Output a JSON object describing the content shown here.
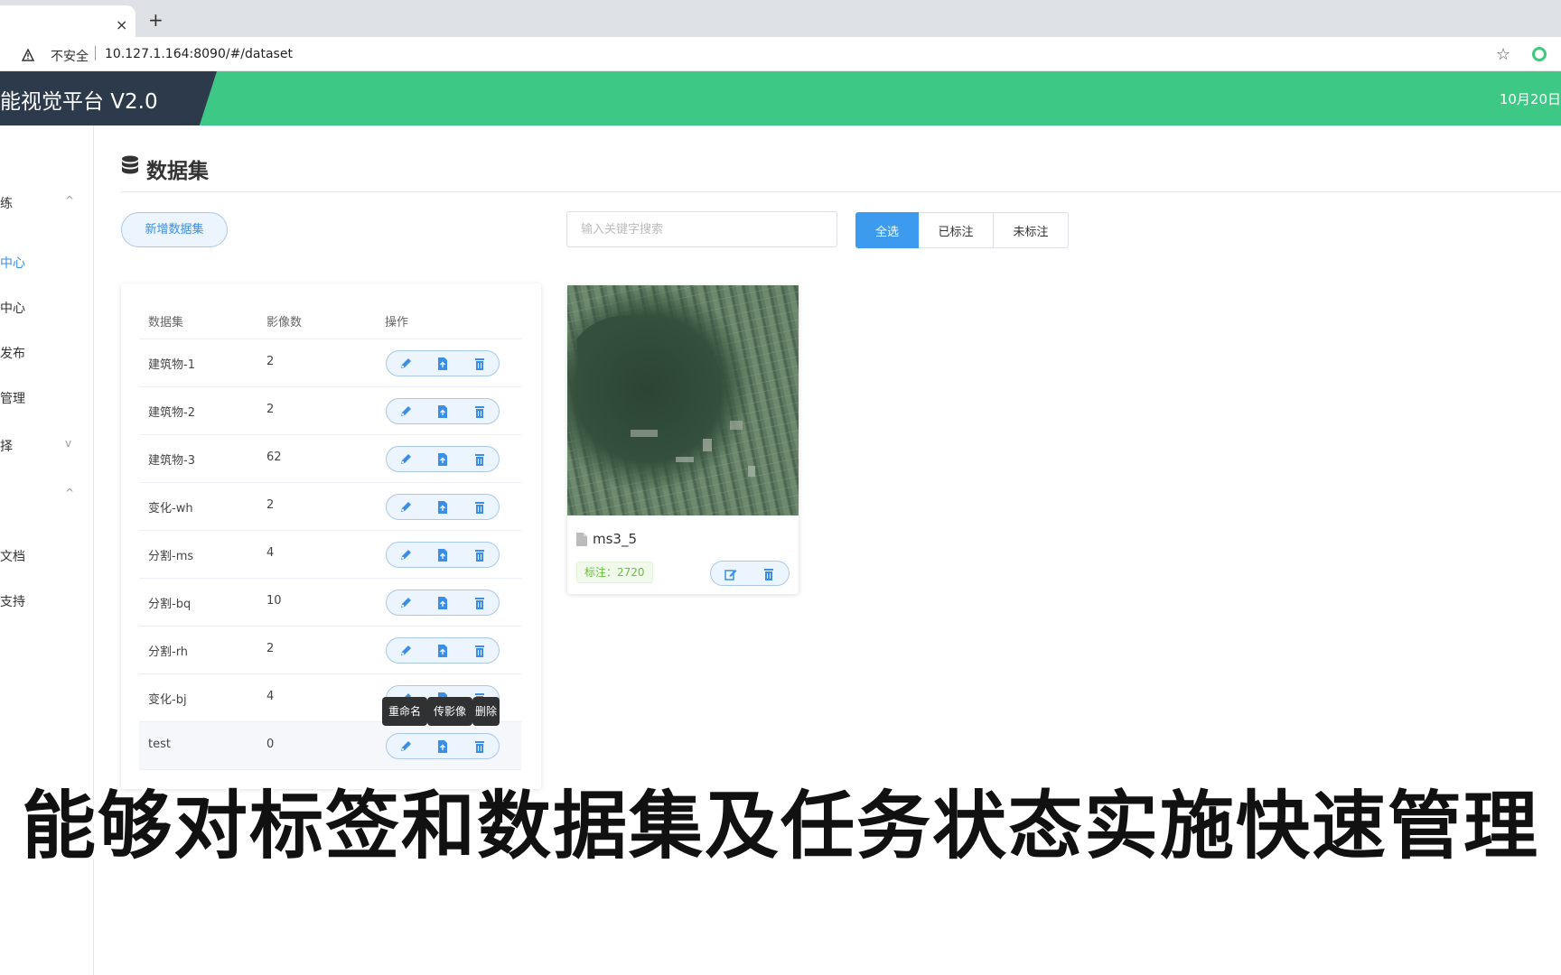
{
  "browser": {
    "tab_close": "×",
    "new_tab": "+",
    "insecure_label": "不安全",
    "url": "10.127.1.164:8090/#/dataset",
    "star": "☆"
  },
  "header": {
    "title": "能视觉平台 V2.0",
    "date": "10月20日"
  },
  "sidebar": {
    "items": [
      {
        "label": "练",
        "chevron": "^"
      },
      {
        "label": "中心",
        "active": true
      },
      {
        "label": "中心"
      },
      {
        "label": "发布"
      },
      {
        "label": "管理"
      },
      {
        "label": "择",
        "chevron": "v"
      },
      {
        "label": "",
        "chevron": "^"
      },
      {
        "label": "文档"
      },
      {
        "label": "支持"
      }
    ]
  },
  "page": {
    "title": "数据集",
    "add_button": "新增数据集",
    "search_placeholder": "输入关键字搜索",
    "filters": [
      "全选",
      "已标注",
      "未标注"
    ],
    "active_filter": "全选"
  },
  "table": {
    "headers": [
      "数据集",
      "影像数",
      "操作"
    ],
    "rows": [
      {
        "name": "建筑物-1",
        "count": "2"
      },
      {
        "name": "建筑物-2",
        "count": "2"
      },
      {
        "name": "建筑物-3",
        "count": "62"
      },
      {
        "name": "变化-wh",
        "count": "2"
      },
      {
        "name": "分割-ms",
        "count": "4"
      },
      {
        "name": "分割-bq",
        "count": "10"
      },
      {
        "name": "分割-rh",
        "count": "2"
      },
      {
        "name": "变化-bj",
        "count": "4"
      },
      {
        "name": "test",
        "count": "0"
      }
    ],
    "tooltips": [
      "重命名",
      "传影像",
      "删除"
    ]
  },
  "image_card": {
    "name": "ms3_5",
    "label_badge": "标注：2720"
  },
  "caption": "能够对标签和数据集及任务状态实施快速管理",
  "colors": {
    "header_green": "#3ec885",
    "brand_dark": "#2d3a4b",
    "primary_blue": "#3d9bef"
  }
}
